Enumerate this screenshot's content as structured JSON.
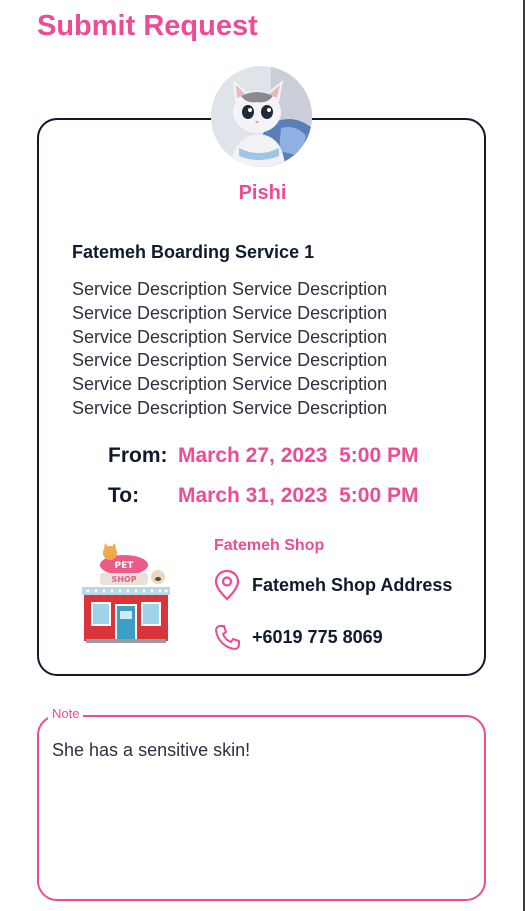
{
  "page": {
    "title": "Submit Request"
  },
  "pet": {
    "name": "Pishi",
    "avatar_icon": "kitten-photo"
  },
  "service": {
    "title": "Fatemeh Boarding Service 1",
    "description": "Service Description Service Description Service Description Service Description Service Description Service Description Service Description Service Description Service Description Service Description Service Description Service Description"
  },
  "schedule": {
    "from_label": "From:",
    "from_value": "March 27, 2023  5:00 PM",
    "to_label": "To:",
    "to_value": "March 31, 2023  5:00 PM"
  },
  "shop": {
    "name": "Fatemeh Shop",
    "address": "Fatemeh Shop Address",
    "phone": "+6019 775 8069",
    "image_icon": "pet-shop-illustration",
    "image_sign_text": "PET SHOP"
  },
  "note": {
    "label": "Note",
    "value": "She has a sensitive skin!"
  },
  "colors": {
    "accent": "#ec4c96",
    "text_dark": "#0f1b2d",
    "card_border": "#0f1b2d"
  }
}
